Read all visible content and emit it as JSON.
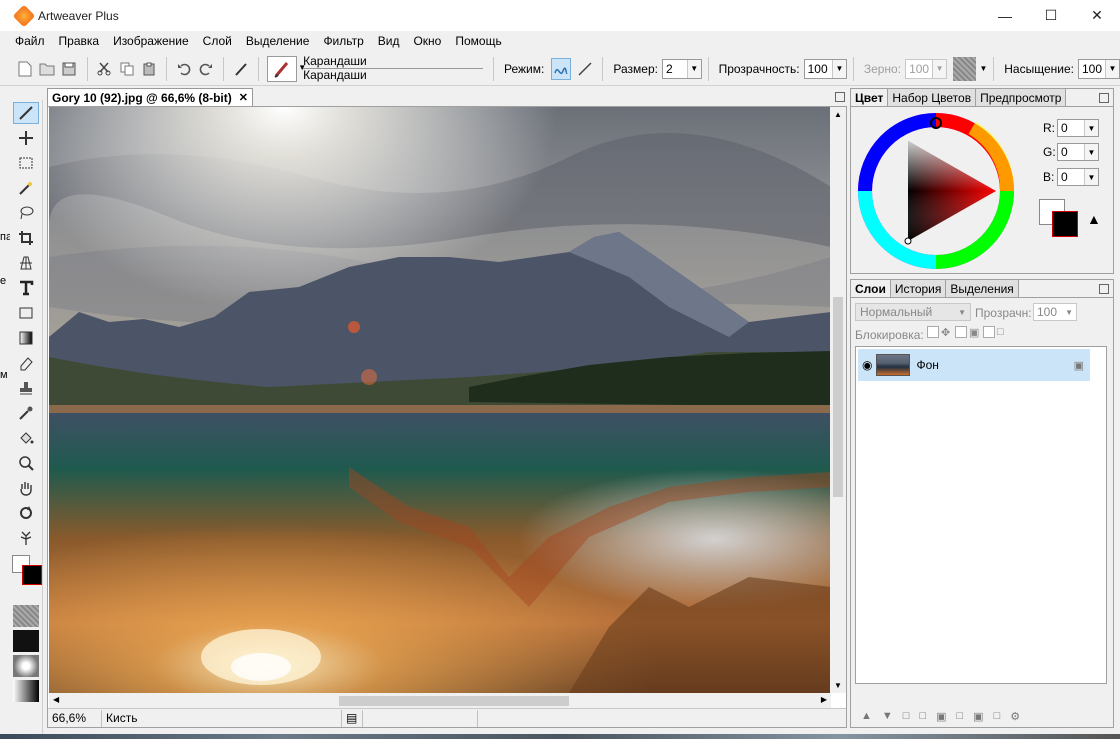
{
  "window": {
    "title": "Artweaver Plus"
  },
  "menu": [
    "Файл",
    "Правка",
    "Изображение",
    "Слой",
    "Выделение",
    "Фильтр",
    "Вид",
    "Окно",
    "Помощь"
  ],
  "toolbar": {
    "brush_category": "Карандаши",
    "brush_name": "Карандаши",
    "mode_label": "Режим:",
    "size_label": "Размер:",
    "size_value": "2",
    "opacity_label": "Прозрачность:",
    "opacity_value": "100",
    "grain_label": "Зерно:",
    "grain_value": "100",
    "saturation_label": "Насыщение:",
    "saturation_value": "100"
  },
  "document": {
    "tab_title": "Gory 10 (92).jpg @ 66,6% (8-bit)",
    "zoom": "66,6%",
    "tool_name": "Кисть"
  },
  "color_panel": {
    "tabs": [
      "Цвет",
      "Набор Цветов",
      "Предпросмотр"
    ],
    "r_label": "R:",
    "r_value": "0",
    "g_label": "G:",
    "g_value": "0",
    "b_label": "B:",
    "b_value": "0"
  },
  "layers_panel": {
    "tabs": [
      "Слои",
      "История",
      "Выделения"
    ],
    "blend_mode": "Нормальный",
    "opacity_label": "Прозрачн:",
    "opacity_value": "100",
    "lock_label": "Блокировка:",
    "layers": [
      {
        "name": "Фон"
      }
    ]
  },
  "left_edge_text": [
    "па",
    "е",
    "м"
  ],
  "colors": {
    "accent": "#cce4f7",
    "foreground": "#000000",
    "background": "#ffffff"
  }
}
